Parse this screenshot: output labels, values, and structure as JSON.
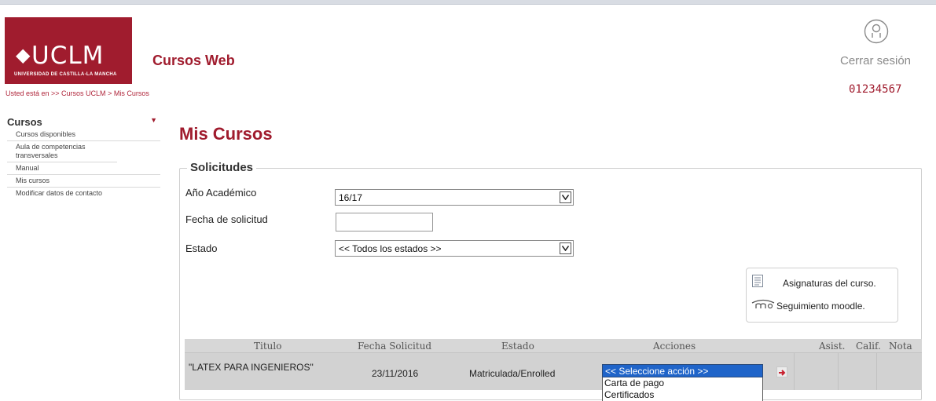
{
  "header": {
    "logo_name": "UCLM",
    "logo_subtitle": "UNIVERSIDAD DE CASTILLA-LA MANCHA",
    "app_title": "Cursos Web",
    "logout_label": "Cerrar sesión",
    "user_id": "01234567"
  },
  "breadcrumb": {
    "prefix": "Usted está en >> ",
    "items": [
      "Cursos UCLM",
      "Mis Cursos"
    ],
    "separator": " > "
  },
  "sidebar": {
    "heading": "Cursos",
    "items": [
      {
        "label": "Cursos disponibles"
      },
      {
        "label": "Aula de competencias transversales"
      },
      {
        "label": "Manual"
      },
      {
        "label": "Mis cursos"
      },
      {
        "label": "Modificar datos de contacto"
      }
    ]
  },
  "main": {
    "title": "Mis Cursos",
    "fieldset_legend": "Solicitudes",
    "filters": {
      "year_label": "Año Académico",
      "year_value": "16/17",
      "date_label": "Fecha de solicitud",
      "date_value": "",
      "state_label": "Estado",
      "state_value": "<< Todos los estados >>"
    },
    "legend": {
      "subjects_label": "Asignaturas del curso.",
      "moodle_label": "Seguimiento moodle."
    },
    "table": {
      "columns": [
        "Titulo",
        "Fecha Solicitud",
        "Estado",
        "Acciones",
        "Asist.",
        "Calif.",
        "Nota"
      ],
      "rows": [
        {
          "titulo": "\"LATEX PARA INGENIEROS\"",
          "fecha": "23/11/2016",
          "estado": "Matriculada/Enrolled",
          "accion_selected": "<< Seleccione acción >>",
          "accion_options": [
            "Carta de pago",
            "Certificados"
          ],
          "asist": "",
          "calif": "",
          "nota": ""
        }
      ]
    }
  },
  "colors": {
    "brand": "#a01c2e",
    "selection": "#1f64c9"
  }
}
